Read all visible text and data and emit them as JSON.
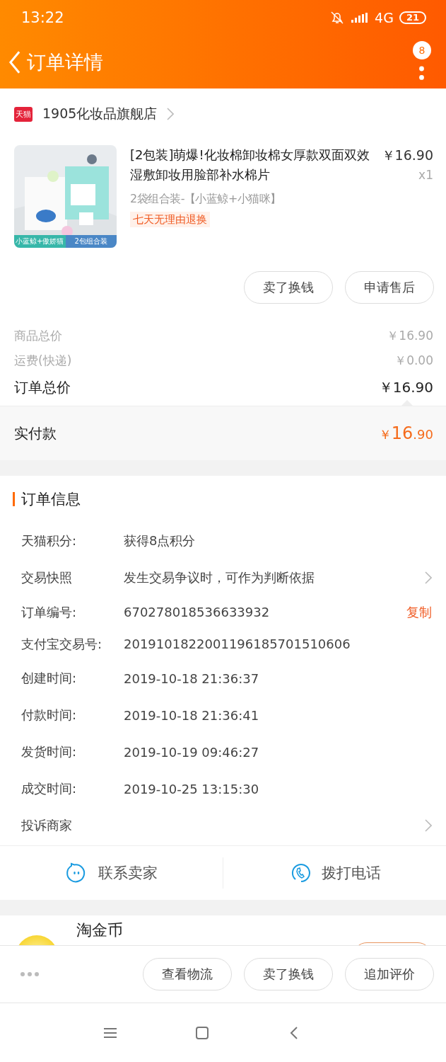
{
  "status_bar": {
    "time": "13:22",
    "network": "4G",
    "battery": "21"
  },
  "header": {
    "title": "订单详情",
    "badge": "8"
  },
  "shop": {
    "platform_tag": "天猫",
    "name": "1905化妆品旗舰店"
  },
  "product": {
    "image": {
      "kind": "picture",
      "labels": [
        "小蓝鲸+傲娇猫",
        "2包组合装"
      ]
    },
    "title": "[2包装]萌爆!化妆棉卸妆棉女厚款双面双效湿敷卸妆用脸部补水棉片",
    "price": "￥16.90",
    "quantity": "x1",
    "variant": "2袋组合装-【小蓝鲸+小猫咪】",
    "tag": "七天无理由退换"
  },
  "item_actions": [
    "卖了换钱",
    "申请售后"
  ],
  "price_summary": [
    {
      "label": "商品总价",
      "value": "￥16.90",
      "emphasis": false
    },
    {
      "label": "运费(快递)",
      "value": "￥0.00",
      "emphasis": false
    },
    {
      "label": "订单总价",
      "value": "￥16.90",
      "emphasis": true
    }
  ],
  "paid": {
    "label": "实付款",
    "currency": "￥",
    "integer": "16",
    "decimal": ".90"
  },
  "order_info": {
    "title": "订单信息",
    "rows": [
      {
        "kind": "plain",
        "label": "天猫积分:",
        "value": "获得8点积分"
      },
      {
        "kind": "link",
        "label": "交易快照",
        "value": "发生交易争议时，可作为判断依据"
      },
      {
        "kind": "copy",
        "label": "订单编号:",
        "value": "670278018536633932",
        "action_text": "复制"
      },
      {
        "kind": "plain",
        "label": "支付宝交易号:",
        "value": "2019101822001196185701510606"
      },
      {
        "kind": "plain",
        "label": "创建时间:",
        "value": "2019-10-18 21:36:37"
      },
      {
        "kind": "plain",
        "label": "付款时间:",
        "value": "2019-10-18 21:36:41"
      },
      {
        "kind": "plain",
        "label": "发货时间:",
        "value": "2019-10-19 09:46:27"
      },
      {
        "kind": "plain",
        "label": "成交时间:",
        "value": "2019-10-25 13:15:30"
      },
      {
        "kind": "link",
        "label": "投诉商家"
      }
    ]
  },
  "contact": [
    {
      "kind": "chat",
      "label": "联系卖家"
    },
    {
      "kind": "phone",
      "label": "拨打电话"
    }
  ],
  "coins": {
    "label": "淘金币"
  },
  "bottom_actions": [
    "查看物流",
    "卖了换钱",
    "追加评价"
  ]
}
